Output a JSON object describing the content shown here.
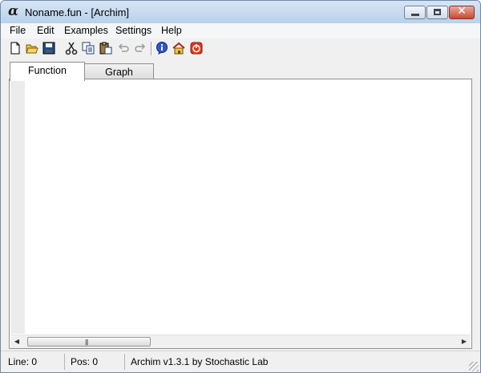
{
  "window": {
    "app_glyph": "α",
    "title": "Noname.fun - [Archim]",
    "close_glyph": "✕"
  },
  "menu": [
    "File",
    "Edit",
    "Examples",
    "Settings",
    "Help"
  ],
  "toolbar": {
    "icons": [
      "new-icon",
      "open-icon",
      "save-icon",
      "cut-icon",
      "copy-icon",
      "paste-icon",
      "undo-icon",
      "redo-icon",
      "info-icon",
      "home-icon",
      "power-icon"
    ],
    "disabled": [
      "undo-icon",
      "redo-icon"
    ]
  },
  "tabs": [
    {
      "label": "Function",
      "active": true
    },
    {
      "label": "Graph",
      "active": false
    }
  ],
  "editor": {
    "content": "",
    "scroll_left_glyph": "◀",
    "scroll_right_glyph": "▶",
    "grip_glyph": "|||"
  },
  "status": {
    "line": "Line: 0",
    "pos": "Pos: 0",
    "info": "Archim v1.3.1 by Stochastic Lab"
  },
  "colors": {
    "title_gradient_top": "#d6e5f5",
    "close_button": "#c74b33",
    "info_icon": "#2f57c9",
    "power_icon": "#e0391f"
  }
}
